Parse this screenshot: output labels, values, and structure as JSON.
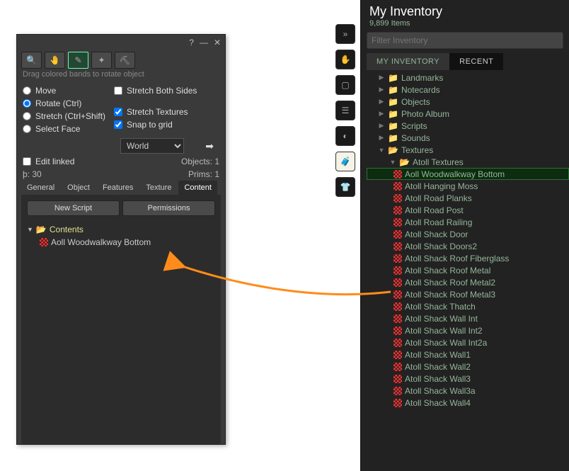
{
  "editWindow": {
    "hint": "Drag colored bands to rotate object",
    "radios": {
      "move": "Move",
      "rotate": "Rotate (Ctrl)",
      "stretch": "Stretch (Ctrl+Shift)",
      "selectFace": "Select Face"
    },
    "checks": {
      "stretchBoth": "Stretch Both Sides",
      "stretchTex": "Stretch Textures",
      "snap": "Snap to grid"
    },
    "coordSpace": "World",
    "editLinked": "Edit linked",
    "pval": "þ: 30",
    "objects": "Objects: 1",
    "prims": "Prims: 1",
    "tabs": {
      "general": "General",
      "object": "Object",
      "features": "Features",
      "texture": "Texture",
      "content": "Content"
    },
    "buttons": {
      "newScript": "New Script",
      "permissions": "Permissions"
    },
    "contentsLabel": "Contents",
    "contentsItem": "Aoll Woodwalkway Bottom"
  },
  "inventory": {
    "title": "My Inventory",
    "subtitle": "9,899 Items",
    "filterPlaceholder": "Filter Inventory",
    "tabs": {
      "my": "MY INVENTORY",
      "recent": "RECENT"
    },
    "folders": [
      "Landmarks",
      "Notecards",
      "Objects",
      "Photo Album",
      "Scripts",
      "Sounds"
    ],
    "texturesLabel": "Textures",
    "subfolder": "Atoll Textures",
    "textures": [
      "Aoll Woodwalkway Bottom",
      "Atoll Hanging Moss",
      "Atoll Road Planks",
      "Atoll Road Post",
      "Atoll Road Railing",
      "Atoll Shack Door",
      "Atoll Shack Doors2",
      "Atoll Shack Roof Fiberglass",
      "Atoll Shack Roof Metal",
      "Atoll Shack Roof Metal2",
      "Atoll Shack Roof Metal3",
      "Atoll Shack Thatch",
      "Atoll Shack Wall  Int",
      "Atoll Shack Wall  Int2",
      "Atoll Shack Wall  Int2a",
      "Atoll Shack Wall1",
      "Atoll Shack Wall2",
      "Atoll Shack Wall3",
      "Atoll Shack Wall3a",
      "Atoll Shack Wall4"
    ]
  }
}
